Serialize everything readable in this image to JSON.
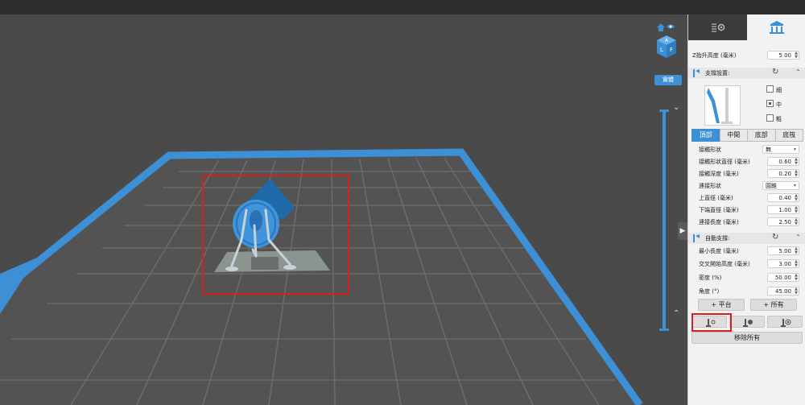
{
  "viewport": {
    "solid_label": "實體"
  },
  "panel": {
    "tabs": [
      {
        "icon": "gear-settings-icon",
        "active": false
      },
      {
        "icon": "support-structure-icon",
        "active": true
      }
    ],
    "z_lift": {
      "label": "Z抬升高度 (毫米)",
      "value": "5.00"
    },
    "support_settings": {
      "title": "支撐設置:",
      "sizes": [
        {
          "label": "細",
          "checked": false
        },
        {
          "label": "中",
          "checked": true
        },
        {
          "label": "粗",
          "checked": false
        }
      ],
      "segments": [
        "頂部",
        "中間",
        "底部",
        "底筏"
      ],
      "active_segment": "頂部",
      "rows": [
        {
          "label": "接觸形狀",
          "kind": "select",
          "value": "無"
        },
        {
          "label": "接觸形狀直徑 (毫米)",
          "kind": "number",
          "value": "0.60"
        },
        {
          "label": "接觸深度 (毫米)",
          "kind": "number",
          "value": "0.20"
        },
        {
          "label": "連接形狀",
          "kind": "select",
          "value": "圓錐"
        },
        {
          "label": "上直徑 (毫米)",
          "kind": "number",
          "value": "0.40"
        },
        {
          "label": "下端直徑 (毫米)",
          "kind": "number",
          "value": "1.00"
        },
        {
          "label": "連接長度 (毫米)",
          "kind": "number",
          "value": "2.50"
        }
      ]
    },
    "auto_support": {
      "title": "自動支撐:",
      "rows": [
        {
          "label": "最小長度 (毫米)",
          "value": "5.00"
        },
        {
          "label": "交叉開始高度 (毫米)",
          "value": "3.00"
        },
        {
          "label": "密度 (%)",
          "value": "50.00"
        },
        {
          "label": "角度 (°)",
          "value": "45.00"
        }
      ]
    },
    "buttons": {
      "platform": "+ 平台",
      "all": "+ 所有",
      "remove_all": "移除所有"
    }
  },
  "colors": {
    "accent": "#3d8fd6",
    "highlight": "#d42020",
    "viewport_bg": "#4a4a4a",
    "panel_bg": "#f2f2f2"
  }
}
